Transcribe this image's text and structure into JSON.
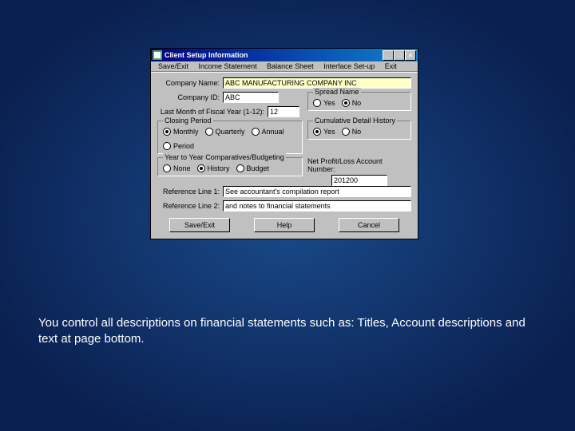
{
  "titlebar": {
    "title": "Client Setup Information"
  },
  "menu": {
    "m0": "Save/Exit",
    "m1": "Income Statement",
    "m2": "Balance Sheet",
    "m3": "Interface Set-up",
    "m4": "Exit"
  },
  "labels": {
    "company_name": "Company Name:",
    "company_id": "Company ID:",
    "last_month": "Last Month of Fiscal Year (1-12):",
    "ref1": "Reference Line 1:",
    "ref2": "Reference Line 2:",
    "net_profit_loss": "Net Profit/Loss Account Number:"
  },
  "values": {
    "company_name": "ABC MANUFACTURING COMPANY INC",
    "company_id": "ABC",
    "last_month": "12",
    "net_profit_loss": "201200",
    "ref1": "See accountant's compilation report",
    "ref2": "and notes to financial statements"
  },
  "groups": {
    "spread": {
      "legend": "Spread Name",
      "yes": "Yes",
      "no": "No"
    },
    "closing": {
      "legend": "Closing Period",
      "monthly": "Monthly",
      "quarterly": "Quarterly",
      "annual": "Annual",
      "period": "Period"
    },
    "cumulative": {
      "legend": "Cumulative Detail History",
      "yes": "Yes",
      "no": "No"
    },
    "yty": {
      "legend": "Year to Year Comparatives/Budgeting",
      "none": "None",
      "history": "History",
      "budget": "Budget"
    }
  },
  "buttons": {
    "save_exit": "Save/Exit",
    "help": "Help",
    "cancel": "Cancel"
  },
  "caption": "You control all descriptions on financial statements such as: Titles, Account descriptions and text at page bottom."
}
